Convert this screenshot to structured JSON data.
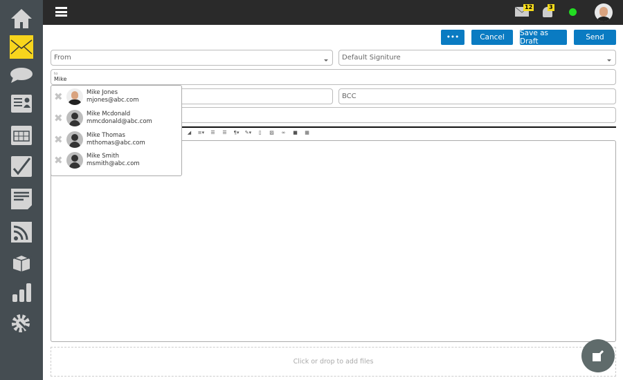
{
  "sidebar": {
    "items": [
      {
        "icon": "home-icon"
      },
      {
        "icon": "mail-icon",
        "active": true
      },
      {
        "icon": "chat-icon"
      },
      {
        "icon": "contacts-icon"
      },
      {
        "icon": "calendar-icon"
      },
      {
        "icon": "tasks-icon"
      },
      {
        "icon": "notes-icon"
      },
      {
        "icon": "rss-icon"
      },
      {
        "icon": "box-icon"
      },
      {
        "icon": "stats-icon"
      },
      {
        "icon": "settings-icon"
      }
    ]
  },
  "topbar": {
    "mail_count": "12",
    "notif_count": "3",
    "status_color": "#22dd22"
  },
  "actions": {
    "more": "•••",
    "cancel": "Cancel",
    "save_draft": "Save as Draft",
    "send": "Send"
  },
  "form": {
    "from_placeholder": "From",
    "signature": "Default Signiture",
    "to_label": "to",
    "to_value": "Mike",
    "bcc_placeholder": "BCC"
  },
  "suggestions": [
    {
      "name": "Mike Jones",
      "email": "mjones@abc.com",
      "photo": true
    },
    {
      "name": "Mike Mcdonald",
      "email": "mmcdonald@abc.com"
    },
    {
      "name": "Mike Thomas",
      "email": "mthomas@abc.com"
    },
    {
      "name": "Mike Smith",
      "email": "msmith@abc.com"
    }
  ],
  "toolbar": [
    "eraser-icon",
    "align-icon",
    "ordered-list-icon",
    "unordered-list-icon",
    "paragraph-icon",
    "pen-icon",
    "file-icon",
    "image-icon",
    "link-icon",
    "video-icon",
    "table-icon"
  ],
  "dropzone": {
    "text": "Click or drop to add files"
  },
  "colors": {
    "accent": "#0a7bc2",
    "sidebar": "#454d52",
    "active_icon": "#f7d51d"
  }
}
